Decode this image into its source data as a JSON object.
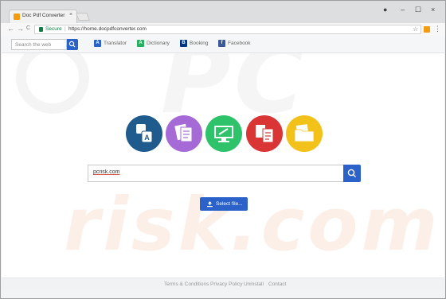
{
  "browser": {
    "tab_title": "Doc Pdf Converter",
    "tab_close": "×",
    "window_controls": {
      "profile": "●",
      "minimize": "–",
      "maximize": "☐",
      "close": "×"
    },
    "nav": {
      "back": "←",
      "forward": "→",
      "reload": "C"
    },
    "secure_label": "Secure",
    "separator": "|",
    "url": "https://home.docpdfconverter.com",
    "star": "☆",
    "menu": "⋮"
  },
  "page_toolbar": {
    "search_placeholder": "Search the web",
    "links": [
      {
        "label": "Translator",
        "icon": "translator-icon",
        "color": "#2a62c9"
      },
      {
        "label": "Dictionary",
        "icon": "dictionary-icon",
        "color": "#27ae60"
      },
      {
        "label": "Booking",
        "icon": "booking-icon",
        "color": "#003580"
      },
      {
        "label": "Facebook",
        "icon": "facebook-icon",
        "color": "#3b5998"
      }
    ]
  },
  "categories": [
    {
      "name": "translate-icon",
      "color": "#1f5b8c"
    },
    {
      "name": "documents-icon",
      "color": "#a56ad6"
    },
    {
      "name": "monitor-edit-icon",
      "color": "#2ec26b"
    },
    {
      "name": "pdf-convert-icon",
      "color": "#d93535"
    },
    {
      "name": "folder-icon",
      "color": "#f2c21b"
    }
  ],
  "main_search": {
    "value": "pcrisk.com"
  },
  "select_file": {
    "label": "Select file..."
  },
  "footer": {
    "links": [
      "Terms & Conditions",
      "Privacy Policy",
      "Uninstall",
      "Contact"
    ]
  },
  "watermark": {
    "top": "PC",
    "bottom": "risk.com"
  },
  "colors": {
    "accent": "#2a62c9",
    "secure": "#0b8043"
  }
}
